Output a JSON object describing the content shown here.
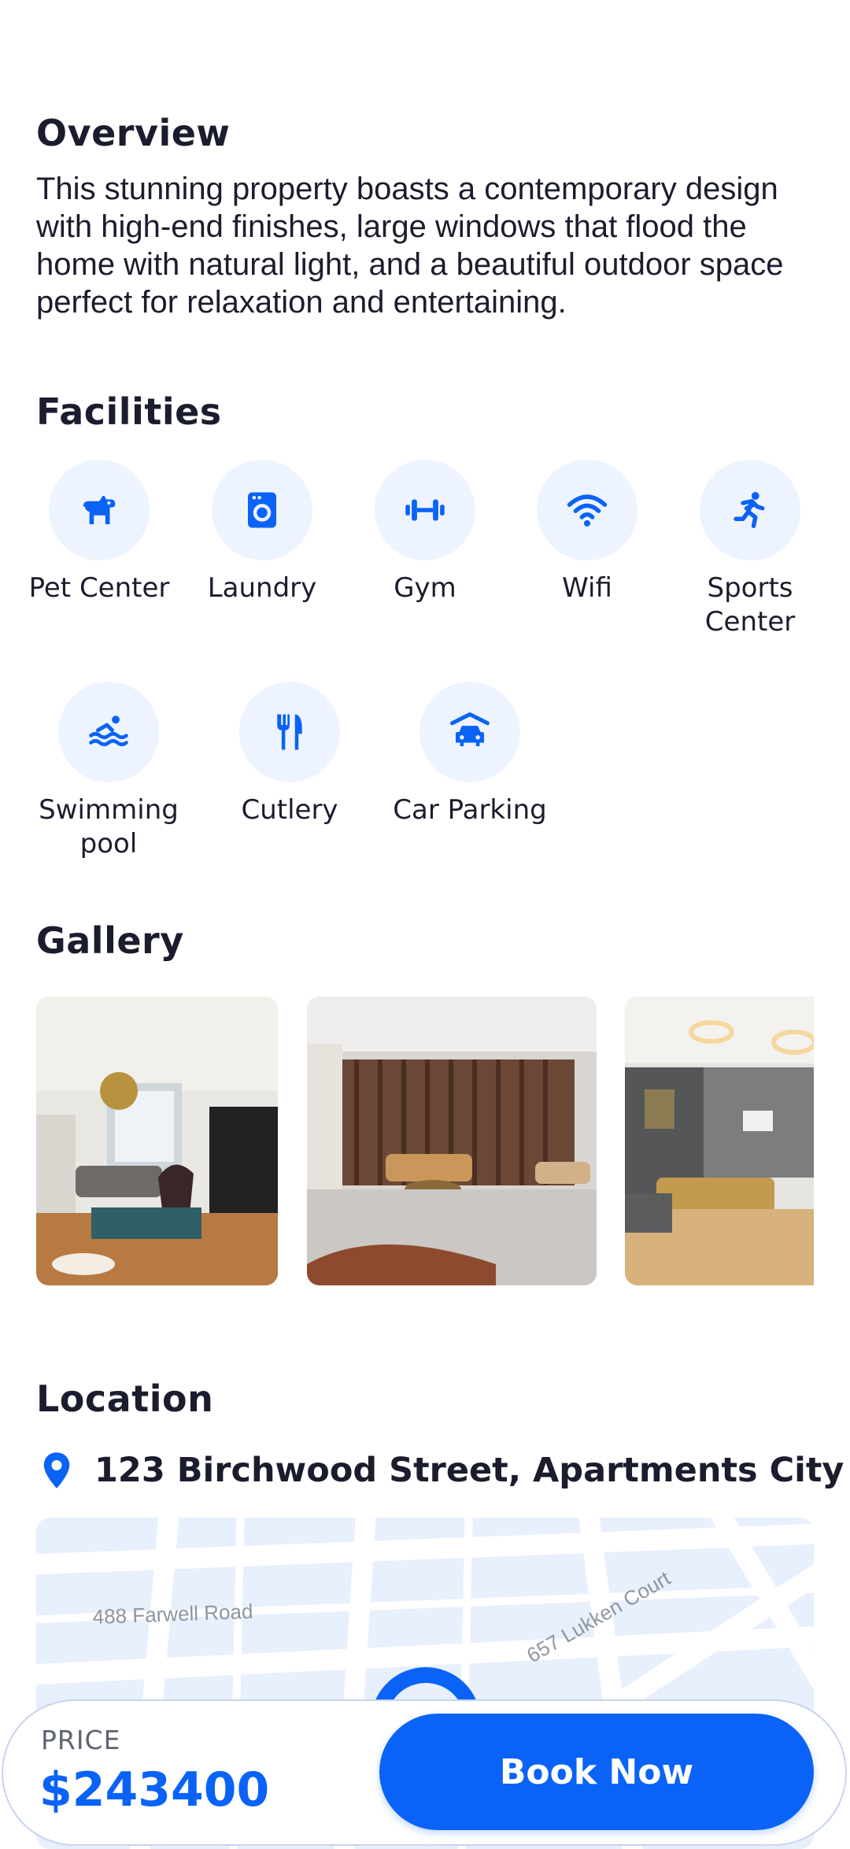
{
  "overview": {
    "title": "Overview",
    "text": "This stunning property boasts a contemporary design with high-end finishes, large windows that flood the home with natural light, and a beautiful outdoor space perfect for relaxation and entertaining."
  },
  "facilities": {
    "title": "Facilities",
    "items": [
      {
        "label": "Pet Center",
        "icon": "dog-icon"
      },
      {
        "label": "Laundry",
        "icon": "washing-machine-icon"
      },
      {
        "label": "Gym",
        "icon": "dumbbell-icon"
      },
      {
        "label": "Wifi",
        "icon": "wifi-icon"
      },
      {
        "label": "Sports Center",
        "icon": "running-icon"
      },
      {
        "label": "Swimming pool",
        "icon": "swimming-icon"
      },
      {
        "label": "Cutlery",
        "icon": "cutlery-icon"
      },
      {
        "label": "Car Parking",
        "icon": "car-parking-icon"
      }
    ]
  },
  "gallery": {
    "title": "Gallery",
    "images": [
      "living-room-photo",
      "lounge-photo",
      "lobby-photo"
    ]
  },
  "location": {
    "title": "Location",
    "address": "123 Birchwood Street, Apartments City",
    "map_labels": [
      "488 Farwell Road",
      "657 Lukken Court"
    ]
  },
  "booking": {
    "price_label": "PRICE",
    "price": "$243400",
    "button_label": "Book Now"
  },
  "colors": {
    "accent": "#0a63f6",
    "icon_bg": "#eef4ff",
    "text": "#1b1d2e"
  }
}
